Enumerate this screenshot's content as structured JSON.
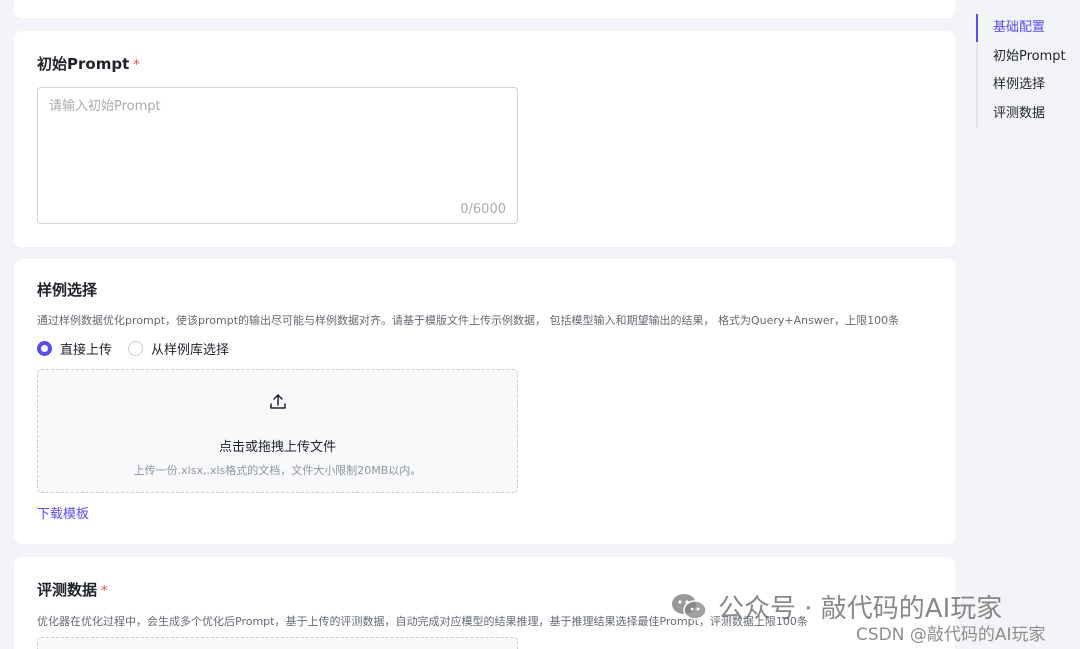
{
  "prompt_section": {
    "title": "初始Prompt",
    "required_mark": "*",
    "placeholder": "请输入初始Prompt",
    "counter": "0/6000"
  },
  "sample_section": {
    "title": "样例选择",
    "description": "通过样例数据优化prompt，使该prompt的输出尽可能与样例数据对齐。请基于模版文件上传示例数据， 包括模型输入和期望输出的结果， 格式为Query+Answer，上限100条",
    "radio_options": [
      {
        "label": "直接上传",
        "checked": true
      },
      {
        "label": "从样例库选择",
        "checked": false
      }
    ],
    "upload": {
      "icon": "upload-icon",
      "title": "点击或拖拽上传文件",
      "hint": "上传一份.xlsx,.xls格式的文档，文件大小限制20MB以内。"
    },
    "download_link": "下载模板"
  },
  "eval_section": {
    "title": "评测数据",
    "required_mark": "*",
    "description": "优化器在优化过程中，会生成多个优化后Prompt，基于上传的评测数据，自动完成对应模型的结果推理，基于推理结果选择最佳Prompt，评测数据上限100条"
  },
  "anchor_nav": {
    "items": [
      {
        "label": "基础配置",
        "active": true
      },
      {
        "label": "初始Prompt",
        "active": false
      },
      {
        "label": "样例选择",
        "active": false
      },
      {
        "label": "评测数据",
        "active": false
      }
    ]
  },
  "watermark": {
    "main": "公众号 · 敲代码的AI玩家",
    "sub": "CSDN @敲代码的AI玩家"
  },
  "colors": {
    "accent": "#5b4cf0",
    "required": "#f54a45",
    "background": "#f3f4f7"
  }
}
